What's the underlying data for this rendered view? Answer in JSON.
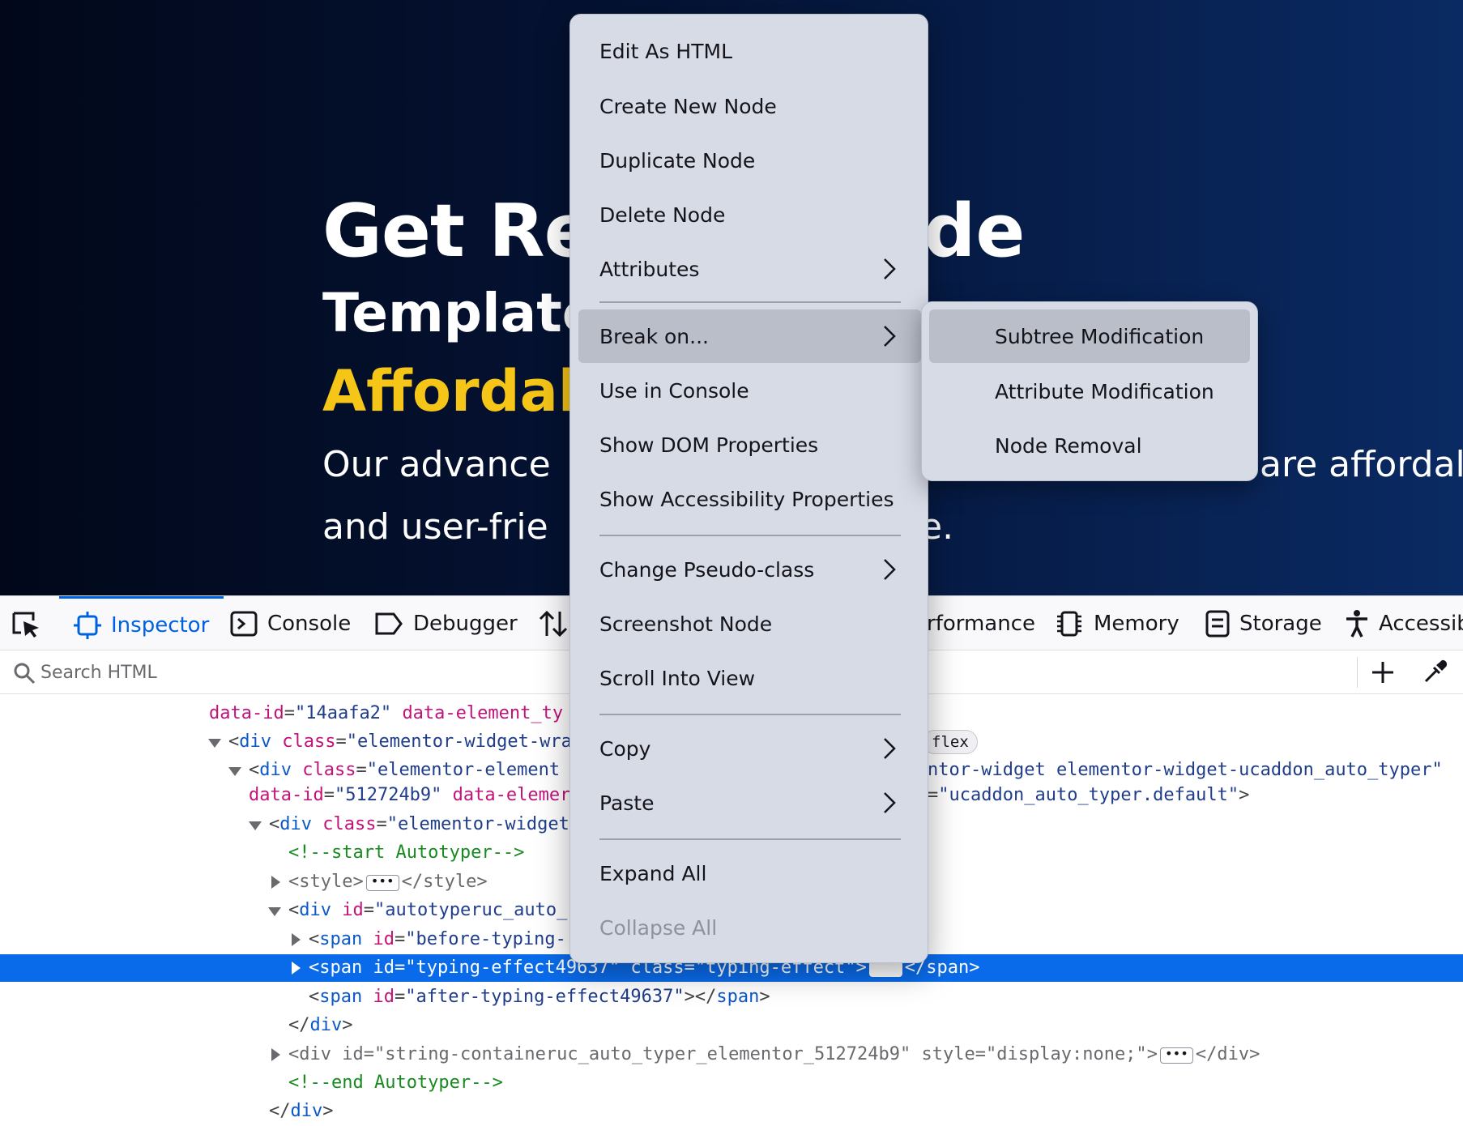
{
  "hero": {
    "line1": "Get Re",
    "line2": "Template",
    "line3": "Affordab",
    "line4": "Our advance",
    "line5": "and user-frie",
    "right_frag1": "de",
    "right_frag2": "are affordal",
    "right_frag3": "e.",
    "accent_color": "#f5c518"
  },
  "toolbar": {
    "tabs": [
      {
        "label": "Inspector",
        "icon": "inspector-icon",
        "active": true
      },
      {
        "label": "Console",
        "icon": "console-icon"
      },
      {
        "label": "Debugger",
        "icon": "debugger-icon"
      },
      {
        "label": "",
        "icon": "network-arrows-icon"
      },
      {
        "label": "rformance",
        "icon": ""
      },
      {
        "label": "Memory",
        "icon": "memory-icon"
      },
      {
        "label": "Storage",
        "icon": "storage-icon"
      },
      {
        "label": "Accessib",
        "icon": "accessibility-icon"
      }
    ],
    "active_color": "#0061e0"
  },
  "search": {
    "placeholder": "Search HTML"
  },
  "tree": {
    "l1": {
      "attr1": "data-id",
      "val1": "\"14aafa2\"",
      "attr2": "data-element_ty"
    },
    "l2": {
      "tag": "div",
      "attr": "class",
      "val": "\"elementor-widget-wra",
      "badge": "flex"
    },
    "l3": {
      "tag": "div",
      "attr": "class",
      "val": "\"elementor-element",
      "right": "ntor-widget elementor-widget-ucaddon_auto_typer\""
    },
    "l4": {
      "attr1": "data-id",
      "val1": "\"512724b9\"",
      "attr2": "data-elemer",
      "right_val": "\"ucaddon_auto_typer.default\""
    },
    "l5": {
      "tag": "div",
      "attr": "class",
      "val": "\"elementor-widget"
    },
    "l6": {
      "comment": "<!--start Autotyper-->"
    },
    "l7": {
      "tag": "style",
      "close": "style"
    },
    "l8": {
      "tag": "div",
      "attr": "id",
      "val": "\"autotyperuc_auto_"
    },
    "l9": {
      "tag": "span",
      "attr": "id",
      "val": "\"before-typing-"
    },
    "l10": {
      "tag": "span",
      "attr1": "id",
      "val1": "\"typing-effect49637\"",
      "attr2": "class",
      "val2": "\"typing-effect\"",
      "close": "span"
    },
    "l11": {
      "tag": "span",
      "attr": "id",
      "val": "\"after-typing-effect49637\"",
      "close": "span"
    },
    "l12": {
      "close": "div"
    },
    "l13": {
      "tag": "div",
      "attr1": "id",
      "val1": "\"string-containeruc_auto_typer_elementor_512724b9\"",
      "attr2": "style",
      "val2": "\"display:none;\"",
      "close": "div"
    },
    "l14": {
      "comment": "<!--end Autotyper-->"
    },
    "l15": {
      "close": "div"
    }
  },
  "context_menu": {
    "items": [
      {
        "label": "Edit As HTML"
      },
      {
        "label": "Create New Node"
      },
      {
        "label": "Duplicate Node"
      },
      {
        "label": "Delete Node"
      },
      {
        "label": "Attributes",
        "submenu": true
      },
      {
        "label": "Break on...",
        "submenu": true,
        "highlighted": true
      },
      {
        "label": "Use in Console"
      },
      {
        "label": "Show DOM Properties"
      },
      {
        "label": "Show Accessibility Properties"
      },
      {
        "label": "Change Pseudo-class",
        "submenu": true
      },
      {
        "label": "Screenshot Node"
      },
      {
        "label": "Scroll Into View"
      },
      {
        "label": "Copy",
        "submenu": true
      },
      {
        "label": "Paste",
        "submenu": true
      },
      {
        "label": "Expand All"
      },
      {
        "label": "Collapse All",
        "disabled": true
      }
    ]
  },
  "submenu": {
    "items": [
      {
        "label": "Subtree Modification",
        "highlighted": true
      },
      {
        "label": "Attribute Modification"
      },
      {
        "label": "Node Removal"
      }
    ]
  },
  "selection_color": "#0a6bea"
}
